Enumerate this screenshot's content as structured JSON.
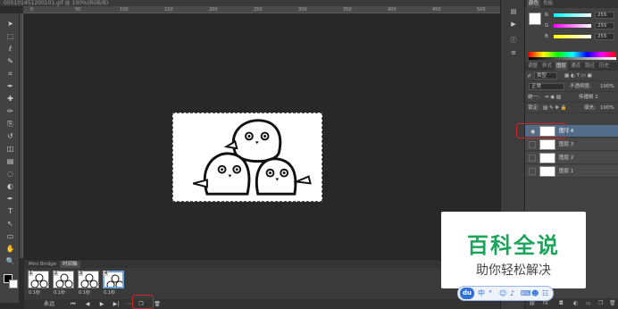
{
  "window": {
    "title": "005101451200101.gif @ 100%(RGB/8)"
  },
  "ruler": {
    "ticks": [
      "0",
      "50",
      "100",
      "150",
      "200",
      "250",
      "300",
      "350",
      "400",
      "450",
      "500"
    ]
  },
  "toolbar": {
    "tools": [
      "move-tool",
      "marquee-tool",
      "lasso-tool",
      "quick-select-tool",
      "crop-tool",
      "eyedropper-tool",
      "healing-brush-tool",
      "brush-tool",
      "clone-stamp-tool",
      "history-brush-tool",
      "eraser-tool",
      "gradient-tool",
      "blur-tool",
      "dodge-tool",
      "pen-tool",
      "type-tool",
      "path-select-tool",
      "shape-tool",
      "hand-tool",
      "zoom-tool"
    ],
    "foreground_color": "#000000",
    "background_color": "#ffffff"
  },
  "timeline": {
    "tabs": [
      "Mini Bridge",
      "时间轴"
    ],
    "active_tab": "时间轴",
    "frames": [
      {
        "number": "1",
        "delay": "0.1秒"
      },
      {
        "number": "2",
        "delay": "0.1秒"
      },
      {
        "number": "3",
        "delay": "0.1秒"
      },
      {
        "number": "4",
        "delay": "0.1秒"
      }
    ],
    "selected_frame": 4,
    "loop_label": "永远",
    "controls": [
      "first-frame",
      "prev-frame",
      "play",
      "next-frame",
      "tween",
      "duplicate-frame",
      "delete-frame"
    ]
  },
  "color_panel": {
    "tabs": [
      "颜色",
      "色板"
    ],
    "active_tab": "颜色",
    "channels": [
      {
        "label": "R",
        "value": "255"
      },
      {
        "label": "G",
        "value": "255"
      },
      {
        "label": "B",
        "value": "255"
      }
    ]
  },
  "layers_panel": {
    "tabs": [
      "调整",
      "样式",
      "图层",
      "通道",
      "路径",
      "历史"
    ],
    "active_tab": "图层",
    "filter_label": "类型",
    "blend_mode": "正常",
    "opacity_label": "不透明度:",
    "opacity_value": "100%",
    "unify_label": "统一:",
    "propagate_label": "传播帧 1",
    "lock_label": "锁定:",
    "fill_label": "填充:",
    "fill_value": "100%",
    "layers": [
      {
        "name": "图层 4",
        "visible": true
      },
      {
        "name": "图层 3",
        "visible": false
      },
      {
        "name": "图层 2",
        "visible": false
      },
      {
        "name": "图层 1",
        "visible": false
      }
    ],
    "selected_layer": "图层 4"
  },
  "watermark": {
    "title": "百科全说",
    "subtitle": "助你轻松解决"
  },
  "ime_bar": {
    "logo": "du",
    "mode": "中",
    "items": [
      "°",
      "☺",
      "♪",
      "⌨",
      "☻",
      "☷"
    ]
  },
  "accent_colors": {
    "highlight_box": "#d0282a",
    "selection": "#536c8c",
    "watermark_green": "#1aa55a"
  }
}
